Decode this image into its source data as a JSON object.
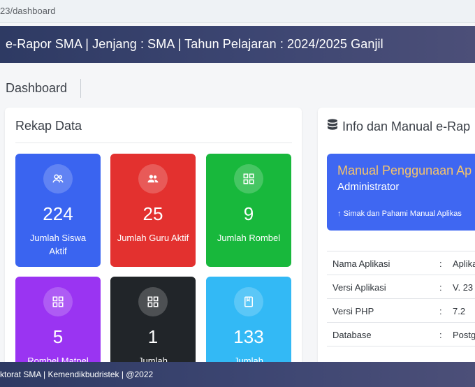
{
  "browser": {
    "url": "23/dashboard"
  },
  "header": {
    "title": "e-Rapor SMA | Jenjang : SMA | Tahun Pelajaran : 2024/2025 Ganjil"
  },
  "page": {
    "title": "Dashboard"
  },
  "rekap": {
    "title": "Rekap Data",
    "tiles": [
      {
        "value": "224",
        "label": "Jumlah Siswa Aktif",
        "color": "#3a64f0",
        "icon": "users-outline-icon"
      },
      {
        "value": "25",
        "label": "Jumlah Guru Aktif",
        "color": "#e3312f",
        "icon": "users-filled-icon"
      },
      {
        "value": "9",
        "label": "Jumlah Rombel",
        "color": "#18b83c",
        "icon": "grid-icon"
      },
      {
        "value": "5",
        "label": "Rombel Matpel",
        "color": "#9a34f2",
        "icon": "grid-icon"
      },
      {
        "value": "1",
        "label": "Jumlah",
        "color": "#212529",
        "icon": "grid-icon"
      },
      {
        "value": "133",
        "label": "Jumlah",
        "color": "#33b9f5",
        "icon": "book-icon"
      }
    ]
  },
  "info": {
    "title": "Info dan Manual e-Rap",
    "icon": "database-icon",
    "manual": {
      "title": "Manual Penggunaan Ap",
      "subtitle": "Administrator",
      "note": "↑ Simak dan Pahami Manual Aplikas"
    },
    "rows": [
      {
        "key": "Nama Aplikasi",
        "sep": ":",
        "value": "Aplika"
      },
      {
        "key": "Versi Aplikasi",
        "sep": ":",
        "value": "V. 23"
      },
      {
        "key": "Versi PHP",
        "sep": ":",
        "value": "7.2"
      },
      {
        "key": "Database",
        "sep": ":",
        "value": "Postg"
      }
    ]
  },
  "footer": {
    "text": "ktorat SMA | Kemendikbudristek | @2022"
  }
}
